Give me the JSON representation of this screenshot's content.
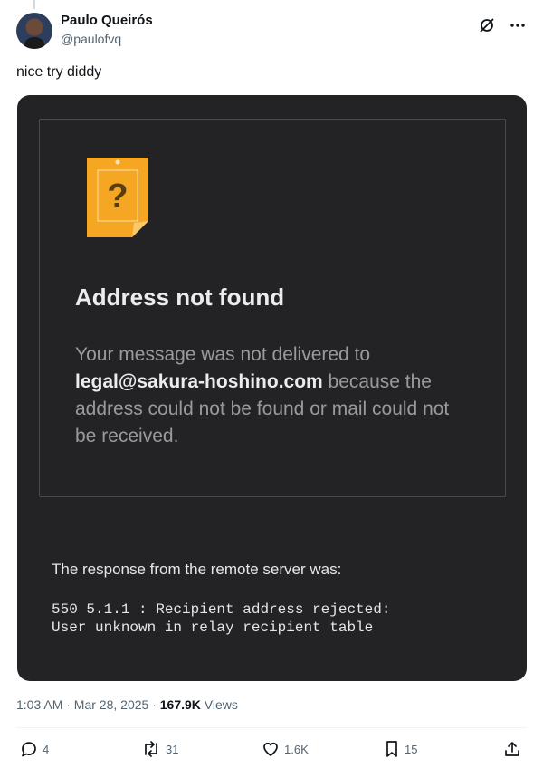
{
  "author": {
    "display_name": "Paulo Queirós",
    "handle": "@paulofvq"
  },
  "tweet": {
    "text": "nice try diddy"
  },
  "media": {
    "title": "Address not found",
    "message_before": "Your message was not delivered to ",
    "address": "legal@sakura-hoshino.com",
    "message_after": " because the address could not be found or mail could not be received.",
    "server_label": "The response from the remote server was:",
    "server_code_line1": "550 5.1.1 : Recipient address rejected:",
    "server_code_line2": "User unknown in relay recipient table",
    "icon_glyph": "?"
  },
  "meta": {
    "time": "1:03 AM · Mar 28, 2025 · ",
    "views_count": "167.9K",
    "views_label": " Views"
  },
  "actions": {
    "replies": "4",
    "reposts": "31",
    "likes": "1.6K",
    "bookmarks": "15"
  },
  "colors": {
    "accent_orange": "#f5a623",
    "card_bg": "#232326",
    "muted": "#536471"
  }
}
